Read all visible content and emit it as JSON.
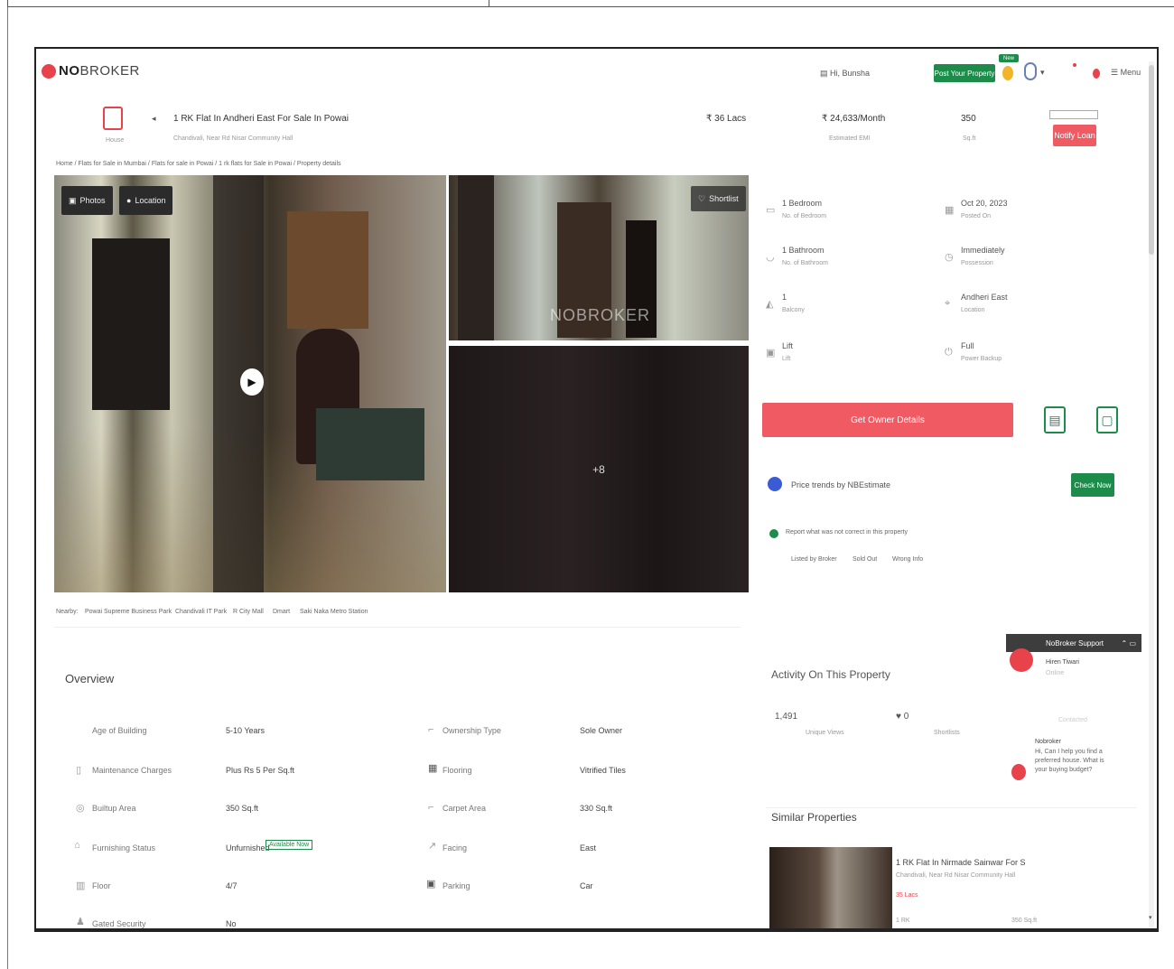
{
  "brand": {
    "logo_bold": "NO",
    "logo_light": "BROKER"
  },
  "header": {
    "post_property_label": "Post Your Property",
    "new_badge": "New",
    "shortlist_text": "Hi, Bunsha",
    "menu_label": "Menu"
  },
  "listing": {
    "type_label": "House",
    "title": "1 RK Flat In Andheri East For Sale In Powai",
    "subtitle": "Chandivali, Near Rd Nisar Community Hall",
    "price": "₹ 36 Lacs",
    "emi": "₹ 24,633/Month",
    "emi_label": "Estimated EMI",
    "area": "350",
    "area_unit": "Sq.ft",
    "enquire_label": "Notify Loan",
    "breadcrumb": "Home  /  Flats for Sale in Mumbai  /  Flats for sale in Powai  /  1 rk flats for Sale in Powai  /  Property details"
  },
  "photos": {
    "photos_chip": "Photos",
    "location_chip": "Location",
    "shortlist_chip": "Shortlist",
    "watermark": "NOBROKER",
    "more_count": "+8"
  },
  "details": [
    {
      "value": "1 Bedroom",
      "label": "No. of Bedroom",
      "icon": "bed-icon"
    },
    {
      "value": "Oct 20, 2023",
      "label": "Posted On",
      "icon": "calendar-icon"
    },
    {
      "value": "1 Bathroom",
      "label": "No. of Bathroom",
      "icon": "bath-icon"
    },
    {
      "value": "Immediately",
      "label": "Possession",
      "icon": "clock-icon"
    },
    {
      "value": "1",
      "label": "Balcony",
      "icon": "balcony-icon"
    },
    {
      "value": "Andheri East",
      "label": "Location",
      "icon": "pin-icon"
    },
    {
      "value": "Lift",
      "label": "Lift",
      "icon": "lift-icon"
    },
    {
      "value": "Full",
      "label": "Power Backup",
      "icon": "plug-icon"
    }
  ],
  "contact": {
    "get_owner_label": "Get Owner Details",
    "price_trends_text": "Price trends by NBEstimate",
    "check_now_label": "Check Now",
    "report_text": "Report what was not correct in this property",
    "report_options": [
      "Listed by Broker",
      "Sold Out",
      "Wrong Info"
    ]
  },
  "nearby": {
    "label": "Nearby:",
    "places": [
      "Powai Supreme Business Park",
      "Chandivali IT Park",
      "R City Mall",
      "Dmart",
      "Saki Naka Metro Station"
    ]
  },
  "overview": {
    "title": "Overview",
    "left_rows": [
      {
        "label": "Age of Building",
        "value": "5-10 Years"
      },
      {
        "label": "Maintenance Charges",
        "value": "Plus Rs 5 Per Sq.ft"
      },
      {
        "label": "Builtup Area",
        "value": "350 Sq.ft"
      },
      {
        "label": "Furnishing Status",
        "value": "Unfurnished",
        "tag": "Available Now"
      },
      {
        "label": "Floor",
        "value": "4/7"
      },
      {
        "label": "Gated Security",
        "value": "No"
      }
    ],
    "right_rows": [
      {
        "label": "Ownership Type",
        "value": "Sole Owner"
      },
      {
        "label": "Flooring",
        "value": "Vitrified Tiles"
      },
      {
        "label": "Carpet Area",
        "value": "330 Sq.ft"
      },
      {
        "label": "Facing",
        "value": "East"
      },
      {
        "label": "Parking",
        "value": "Car"
      }
    ]
  },
  "activity": {
    "title": "Activity On This Property",
    "views": "1,491",
    "views_label": "Unique Views",
    "shortlists": "0",
    "shortlists_label": "Shortlists",
    "contacted_label": "Contacted"
  },
  "support": {
    "header": "NoBroker Support",
    "agent_title": "Hiren Tiwari",
    "agent_sub": "Online",
    "bot_name": "Nobroker",
    "bot_msg": "Hi, Can I help you find a preferred house. What is your buying budget?"
  },
  "similar": {
    "title": "Similar Properties",
    "card_title": "1 RK Flat In Nirmade Sainwar For S",
    "card_sub": "Chandivali, Near Rd Nisar Community Hall",
    "card_price": "35 Lacs",
    "card_meta1": "1 RK",
    "card_meta2": "350 Sq.ft"
  },
  "colors": {
    "brand_red": "#e8424a",
    "accent_green": "#1d8c4a",
    "cta_red": "#f05a63"
  }
}
